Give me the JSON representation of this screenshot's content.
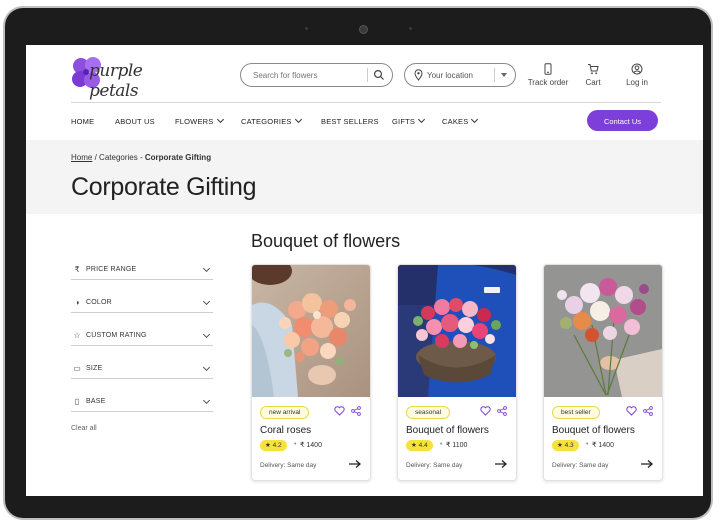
{
  "brand": {
    "logo_text": "purple petals",
    "accent": "#7c3fd9"
  },
  "search": {
    "placeholder": "Search for flowers"
  },
  "location": {
    "label": "Your location"
  },
  "header_actions": [
    {
      "label": "Track order",
      "icon": "phone-icon"
    },
    {
      "label": "Cart",
      "icon": "cart-icon"
    },
    {
      "label": "Log in",
      "icon": "user-icon"
    }
  ],
  "nav": {
    "items": [
      {
        "label": "HOME",
        "dropdown": false
      },
      {
        "label": "ABOUT US",
        "dropdown": false
      },
      {
        "label": "FLOWERS",
        "dropdown": true
      },
      {
        "label": "CATEGORIES",
        "dropdown": true
      },
      {
        "label": "BEST SELLERS",
        "dropdown": false
      },
      {
        "label": "GIFTS",
        "dropdown": true
      },
      {
        "label": "CAKES",
        "dropdown": true
      }
    ],
    "contact_label": "Contact Us"
  },
  "breadcrumb": {
    "home": "Home",
    "sep": "/",
    "categories": "Categories -",
    "current": "Corporate Gifting"
  },
  "page_title": "Corporate Gifting",
  "filters": {
    "items": [
      {
        "label": "PRICE RANGE",
        "icon": "rupee-icon"
      },
      {
        "label": "COLOR",
        "icon": "color-icon"
      },
      {
        "label": "CUSTOM RATING",
        "icon": "star-icon"
      },
      {
        "label": "SIZE",
        "icon": "size-icon"
      },
      {
        "label": "BASE",
        "icon": "base-icon"
      }
    ],
    "clear_label": "Clear all"
  },
  "section_title": "Bouquet of flowers",
  "products": [
    {
      "badge": "new arrival",
      "name": "Coral roses",
      "rating": "★ 4.2",
      "price": "₹ 1400",
      "delivery": "Delivery: Same day"
    },
    {
      "badge": "seasonal",
      "name": "Bouquet of flowers",
      "rating": "★ 4.4",
      "price": "₹ 1100",
      "delivery": "Delivery: Same day"
    },
    {
      "badge": "best seller",
      "name": "Bouquet of flowers",
      "rating": "★ 4.3",
      "price": "₹ 1400",
      "delivery": "Delivery: Same day"
    }
  ]
}
